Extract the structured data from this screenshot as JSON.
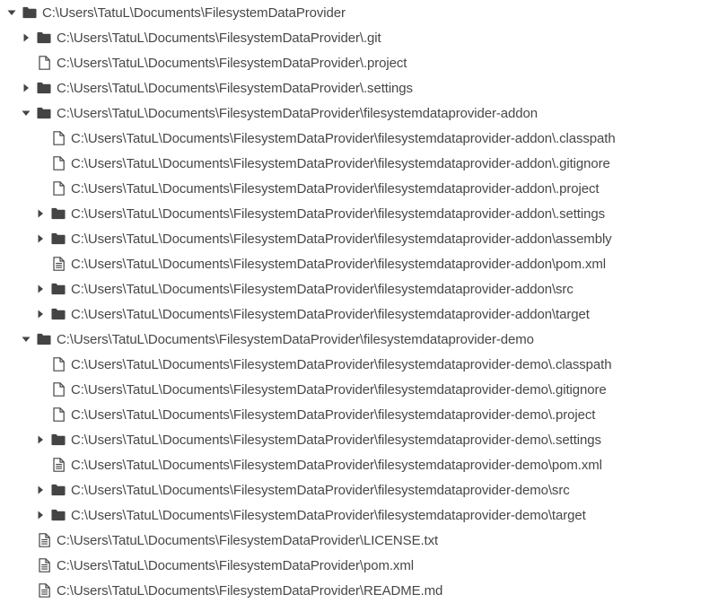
{
  "tree": {
    "items": [
      {
        "label": "C:\\Users\\TatuL\\Documents\\FilesystemDataProvider",
        "type": "folder",
        "level": 0,
        "expanded": true
      },
      {
        "label": "C:\\Users\\TatuL\\Documents\\FilesystemDataProvider\\.git",
        "type": "folder",
        "level": 1,
        "expanded": false
      },
      {
        "label": "C:\\Users\\TatuL\\Documents\\FilesystemDataProvider\\.project",
        "type": "file",
        "level": 1
      },
      {
        "label": "C:\\Users\\TatuL\\Documents\\FilesystemDataProvider\\.settings",
        "type": "folder",
        "level": 1,
        "expanded": false
      },
      {
        "label": "C:\\Users\\TatuL\\Documents\\FilesystemDataProvider\\filesystemdataprovider-addon",
        "type": "folder",
        "level": 1,
        "expanded": true
      },
      {
        "label": "C:\\Users\\TatuL\\Documents\\FilesystemDataProvider\\filesystemdataprovider-addon\\.classpath",
        "type": "file",
        "level": 2
      },
      {
        "label": "C:\\Users\\TatuL\\Documents\\FilesystemDataProvider\\filesystemdataprovider-addon\\.gitignore",
        "type": "file",
        "level": 2
      },
      {
        "label": "C:\\Users\\TatuL\\Documents\\FilesystemDataProvider\\filesystemdataprovider-addon\\.project",
        "type": "file",
        "level": 2
      },
      {
        "label": "C:\\Users\\TatuL\\Documents\\FilesystemDataProvider\\filesystemdataprovider-addon\\.settings",
        "type": "folder",
        "level": 2,
        "expanded": false
      },
      {
        "label": "C:\\Users\\TatuL\\Documents\\FilesystemDataProvider\\filesystemdataprovider-addon\\assembly",
        "type": "folder",
        "level": 2,
        "expanded": false
      },
      {
        "label": "C:\\Users\\TatuL\\Documents\\FilesystemDataProvider\\filesystemdataprovider-addon\\pom.xml",
        "type": "text-file",
        "level": 2
      },
      {
        "label": "C:\\Users\\TatuL\\Documents\\FilesystemDataProvider\\filesystemdataprovider-addon\\src",
        "type": "folder",
        "level": 2,
        "expanded": false
      },
      {
        "label": "C:\\Users\\TatuL\\Documents\\FilesystemDataProvider\\filesystemdataprovider-addon\\target",
        "type": "folder",
        "level": 2,
        "expanded": false
      },
      {
        "label": "C:\\Users\\TatuL\\Documents\\FilesystemDataProvider\\filesystemdataprovider-demo",
        "type": "folder",
        "level": 1,
        "expanded": true
      },
      {
        "label": "C:\\Users\\TatuL\\Documents\\FilesystemDataProvider\\filesystemdataprovider-demo\\.classpath",
        "type": "file",
        "level": 2
      },
      {
        "label": "C:\\Users\\TatuL\\Documents\\FilesystemDataProvider\\filesystemdataprovider-demo\\.gitignore",
        "type": "file",
        "level": 2
      },
      {
        "label": "C:\\Users\\TatuL\\Documents\\FilesystemDataProvider\\filesystemdataprovider-demo\\.project",
        "type": "file",
        "level": 2
      },
      {
        "label": "C:\\Users\\TatuL\\Documents\\FilesystemDataProvider\\filesystemdataprovider-demo\\.settings",
        "type": "folder",
        "level": 2,
        "expanded": false
      },
      {
        "label": "C:\\Users\\TatuL\\Documents\\FilesystemDataProvider\\filesystemdataprovider-demo\\pom.xml",
        "type": "text-file",
        "level": 2
      },
      {
        "label": "C:\\Users\\TatuL\\Documents\\FilesystemDataProvider\\filesystemdataprovider-demo\\src",
        "type": "folder",
        "level": 2,
        "expanded": false
      },
      {
        "label": "C:\\Users\\TatuL\\Documents\\FilesystemDataProvider\\filesystemdataprovider-demo\\target",
        "type": "folder",
        "level": 2,
        "expanded": false
      },
      {
        "label": "C:\\Users\\TatuL\\Documents\\FilesystemDataProvider\\LICENSE.txt",
        "type": "text-file",
        "level": 1
      },
      {
        "label": "C:\\Users\\TatuL\\Documents\\FilesystemDataProvider\\pom.xml",
        "type": "text-file",
        "level": 1
      },
      {
        "label": "C:\\Users\\TatuL\\Documents\\FilesystemDataProvider\\README.md",
        "type": "text-file",
        "level": 1
      }
    ]
  },
  "icons": {
    "folder": "folder-icon",
    "file": "file-icon",
    "text-file": "file-text-icon",
    "expanded": "caret-down-icon",
    "collapsed": "caret-right-icon"
  },
  "colors": {
    "icon": "#444444",
    "text": "#474747",
    "background": "#ffffff"
  }
}
